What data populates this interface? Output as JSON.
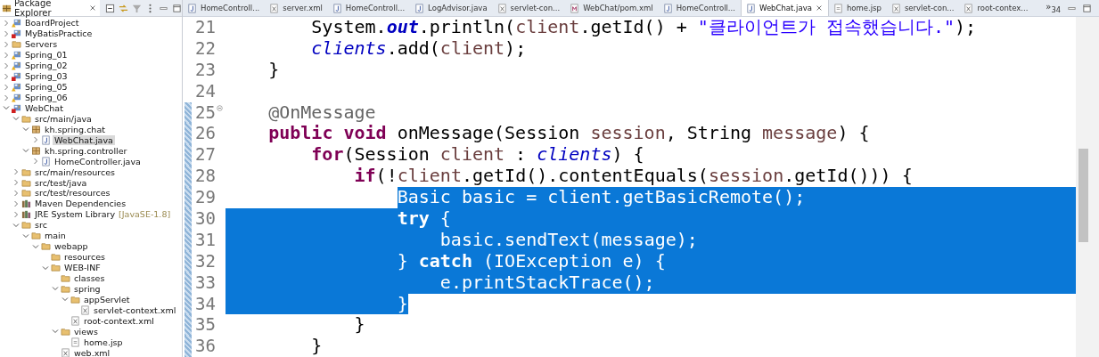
{
  "explorer": {
    "title": "Package Explorer",
    "tree": [
      {
        "label": "BoardProject",
        "kind": "project",
        "error": false,
        "warning": true,
        "expanded": false,
        "selected": false
      },
      {
        "label": "MyBatisPractice",
        "kind": "project",
        "error": true,
        "warning": false,
        "expanded": false,
        "selected": false
      },
      {
        "label": "Servers",
        "kind": "folder",
        "expanded": false,
        "selected": false
      },
      {
        "label": "Spring_01",
        "kind": "project",
        "error": false,
        "warning": true,
        "expanded": false,
        "selected": false
      },
      {
        "label": "Spring_02",
        "kind": "project",
        "error": false,
        "warning": true,
        "expanded": false,
        "selected": false
      },
      {
        "label": "Spring_03",
        "kind": "project",
        "error": true,
        "warning": false,
        "expanded": false,
        "selected": false
      },
      {
        "label": "Spring_05",
        "kind": "project",
        "error": false,
        "warning": true,
        "expanded": false,
        "selected": false
      },
      {
        "label": "Spring_06",
        "kind": "project",
        "error": false,
        "warning": true,
        "expanded": false,
        "selected": false
      },
      {
        "label": "WebChat",
        "kind": "project",
        "error": true,
        "warning": false,
        "expanded": true,
        "selected": false,
        "children": [
          {
            "label": "src/main/java",
            "kind": "folder",
            "expanded": true,
            "selected": false,
            "children": [
              {
                "label": "kh.spring.chat",
                "kind": "package",
                "expanded": true,
                "selected": false,
                "children": [
                  {
                    "label": "WebChat.java",
                    "kind": "java",
                    "expanded": false,
                    "selected": true
                  }
                ]
              },
              {
                "label": "kh.spring.controller",
                "kind": "package",
                "expanded": true,
                "selected": false,
                "children": [
                  {
                    "label": "HomeController.java",
                    "kind": "java",
                    "expanded": false,
                    "selected": false
                  }
                ]
              }
            ]
          },
          {
            "label": "src/main/resources",
            "kind": "folder",
            "expanded": false,
            "selected": false
          },
          {
            "label": "src/test/java",
            "kind": "folder",
            "expanded": false,
            "selected": false
          },
          {
            "label": "src/test/resources",
            "kind": "folder",
            "expanded": false,
            "selected": false
          },
          {
            "label": "Maven Dependencies",
            "kind": "library",
            "expanded": false,
            "selected": false
          },
          {
            "label": "JRE System Library",
            "decoration": "[JavaSE-1.8]",
            "kind": "library",
            "expanded": false,
            "selected": false
          },
          {
            "label": "src",
            "kind": "folder",
            "expanded": true,
            "selected": false,
            "children": [
              {
                "label": "main",
                "kind": "folder",
                "expanded": true,
                "selected": false,
                "children": [
                  {
                    "label": "webapp",
                    "kind": "folder",
                    "expanded": true,
                    "selected": false,
                    "children": [
                      {
                        "label": "resources",
                        "kind": "folder",
                        "selected": false
                      },
                      {
                        "label": "WEB-INF",
                        "kind": "folder",
                        "expanded": true,
                        "selected": false,
                        "children": [
                          {
                            "label": "classes",
                            "kind": "folder",
                            "selected": false
                          },
                          {
                            "label": "spring",
                            "kind": "folder",
                            "expanded": true,
                            "selected": false,
                            "children": [
                              {
                                "label": "appServlet",
                                "kind": "folder",
                                "expanded": true,
                                "selected": false,
                                "children": [
                                  {
                                    "label": "servlet-context.xml",
                                    "kind": "xml",
                                    "selected": false
                                  }
                                ]
                              },
                              {
                                "label": "root-context.xml",
                                "kind": "xml",
                                "selected": false
                              }
                            ]
                          },
                          {
                            "label": "views",
                            "kind": "folder",
                            "expanded": true,
                            "selected": false,
                            "children": [
                              {
                                "label": "home.jsp",
                                "kind": "file",
                                "selected": false
                              }
                            ]
                          },
                          {
                            "label": "web.xml",
                            "kind": "xml",
                            "selected": false
                          }
                        ]
                      }
                    ]
                  }
                ]
              }
            ]
          }
        ]
      }
    ]
  },
  "tabs": [
    {
      "label": "HomeControll...",
      "kind": "java",
      "selected": false
    },
    {
      "label": "server.xml",
      "kind": "xml",
      "selected": false
    },
    {
      "label": "HomeControll...",
      "kind": "java",
      "selected": false
    },
    {
      "label": "LogAdvisor.java",
      "kind": "java",
      "selected": false
    },
    {
      "label": "servlet-con...",
      "kind": "xml",
      "selected": false
    },
    {
      "label": "WebChat/pom.xml",
      "kind": "pom",
      "selected": false
    },
    {
      "label": "HomeControll...",
      "kind": "java",
      "selected": false
    },
    {
      "label": "WebChat.java",
      "kind": "java",
      "selected": true
    },
    {
      "label": "home.jsp",
      "kind": "file",
      "selected": false
    },
    {
      "label": "servlet-con...",
      "kind": "xml",
      "selected": false
    },
    {
      "label": "root-contex...",
      "kind": "xml",
      "selected": false
    }
  ],
  "tab_overflow": "»$_{34}$",
  "lines": [
    {
      "number": "21",
      "kind": "normal",
      "in_range": false,
      "segments": [
        {
          "text": "        System.",
          "kind": "plain"
        },
        {
          "text": "out",
          "kind": "static"
        },
        {
          "text": ".println(",
          "kind": "plain"
        },
        {
          "text": "client",
          "kind": "var"
        },
        {
          "text": ".getId() + ",
          "kind": "plain"
        },
        {
          "text": "\"클라이언트가 접속했습니다.\"",
          "kind": "string"
        },
        {
          "text": ");",
          "kind": "plain"
        }
      ]
    },
    {
      "number": "22",
      "kind": "normal",
      "in_range": false,
      "segments": [
        {
          "text": "        clients",
          "kind": "field"
        },
        {
          "text": ".add(",
          "kind": "plain"
        },
        {
          "text": "client",
          "kind": "var"
        },
        {
          "text": ");",
          "kind": "plain"
        }
      ]
    },
    {
      "number": "23",
      "kind": "normal",
      "in_range": false,
      "segments": [
        {
          "text": "    }",
          "kind": "plain"
        }
      ]
    },
    {
      "number": "24",
      "kind": "normal",
      "in_range": false
    },
    {
      "number": "25",
      "kind": "normal",
      "in_range": true,
      "expanded": true,
      "segments": [
        {
          "text": "    @OnMessage",
          "kind": "annotation"
        }
      ]
    },
    {
      "number": "26",
      "kind": "normal",
      "in_range": true,
      "segments": [
        {
          "text": "    public void",
          "kind": "keyword"
        },
        {
          "text": " onMessage(Session ",
          "kind": "plain"
        },
        {
          "text": "session",
          "kind": "var"
        },
        {
          "text": ", String ",
          "kind": "plain"
        },
        {
          "text": "message",
          "kind": "var"
        },
        {
          "text": ") {",
          "kind": "plain"
        }
      ]
    },
    {
      "number": "27",
      "kind": "normal",
      "in_range": true,
      "segments": [
        {
          "text": "        for",
          "kind": "keyword"
        },
        {
          "text": "(Session ",
          "kind": "plain"
        },
        {
          "text": "client",
          "kind": "var"
        },
        {
          "text": " : ",
          "kind": "plain"
        },
        {
          "text": "clients",
          "kind": "field"
        },
        {
          "text": ") {",
          "kind": "plain"
        }
      ]
    },
    {
      "number": "28",
      "kind": "normal",
      "in_range": true,
      "segments": [
        {
          "text": "            if",
          "kind": "keyword"
        },
        {
          "text": "(!",
          "kind": "plain"
        },
        {
          "text": "client",
          "kind": "var"
        },
        {
          "text": ".getId().contentEquals(",
          "kind": "plain"
        },
        {
          "text": "session",
          "kind": "var"
        },
        {
          "text": ".getId())) {",
          "kind": "plain"
        }
      ]
    },
    {
      "number": "29",
      "kind": "selstart",
      "in_range": true,
      "segments": [
        {
          "text": "                Basic ",
          "kind": "plain"
        },
        {
          "text": "basic",
          "kind": "var"
        },
        {
          "text": " = ",
          "kind": "plain"
        },
        {
          "text": "client",
          "kind": "var"
        },
        {
          "text": ".getBasicRemote();",
          "kind": "plain"
        }
      ]
    },
    {
      "number": "30",
      "kind": "selected",
      "in_range": true,
      "segments": [
        {
          "text": "                try",
          "kind": "keyword"
        },
        {
          "text": " {",
          "kind": "plain"
        }
      ]
    },
    {
      "number": "31",
      "kind": "selected",
      "in_range": true,
      "segments": [
        {
          "text": "                    basic",
          "kind": "var"
        },
        {
          "text": ".sendText(",
          "kind": "plain"
        },
        {
          "text": "message",
          "kind": "var"
        },
        {
          "text": ");",
          "kind": "plain"
        }
      ]
    },
    {
      "number": "32",
      "kind": "selected",
      "in_range": true,
      "segments": [
        {
          "text": "                } ",
          "kind": "plain"
        },
        {
          "text": "catch",
          "kind": "keyword"
        },
        {
          "text": " (IOException ",
          "kind": "plain"
        },
        {
          "text": "e",
          "kind": "var"
        },
        {
          "text": ") {",
          "kind": "plain"
        }
      ]
    },
    {
      "number": "33",
      "kind": "selected",
      "in_range": true,
      "segments": [
        {
          "text": "                    e",
          "kind": "var"
        },
        {
          "text": ".printStackTrace();",
          "kind": "plain"
        }
      ]
    },
    {
      "number": "34",
      "kind": "selend",
      "in_range": true,
      "segments": [
        {
          "text": "                }",
          "kind": "plain"
        }
      ]
    },
    {
      "number": "35",
      "kind": "normal",
      "in_range": true,
      "segments": [
        {
          "text": "            }",
          "kind": "plain"
        }
      ]
    },
    {
      "number": "36",
      "kind": "normal",
      "in_range": true,
      "segments": [
        {
          "text": "        }",
          "kind": "plain"
        }
      ]
    }
  ]
}
